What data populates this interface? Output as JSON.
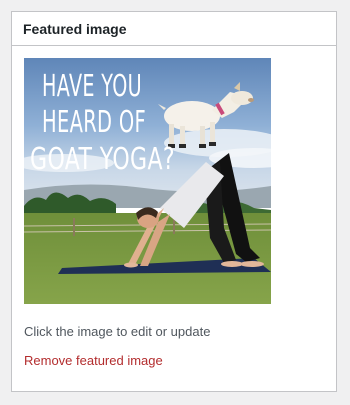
{
  "panel": {
    "title": "Featured image"
  },
  "featured_image": {
    "poster_lines": [
      "HAVE YOU",
      "HEARD OF",
      "GOAT YOGA?"
    ],
    "alt_description": "Goat yoga featured image"
  },
  "hint_text": "Click the image to edit or update",
  "remove_link_label": "Remove featured image",
  "colors": {
    "remove_link": "#b32d2e",
    "panel_border": "#c3c4c7",
    "background": "#f0f0f1"
  }
}
